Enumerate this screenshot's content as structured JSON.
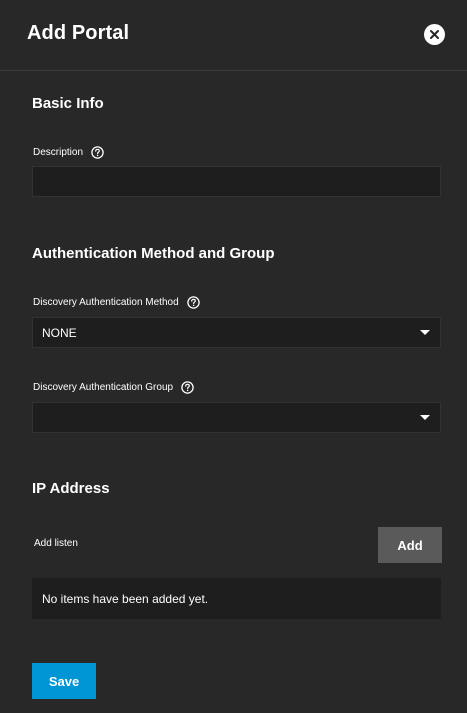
{
  "header": {
    "title": "Add Portal",
    "close_icon": "close-icon"
  },
  "basic_info": {
    "title": "Basic Info",
    "description_label": "Description",
    "description_value": ""
  },
  "auth": {
    "title": "Authentication Method and Group",
    "method_label": "Discovery Authentication Method",
    "method_value": "NONE",
    "group_label": "Discovery Authentication Group",
    "group_value": ""
  },
  "ip": {
    "title": "IP Address",
    "add_listen_label": "Add listen",
    "add_button": "Add",
    "empty_message": "No items have been added yet."
  },
  "actions": {
    "save_button": "Save"
  },
  "colors": {
    "background": "#282828",
    "input_bg": "#1e1e1e",
    "primary": "#0095d5",
    "secondary_button": "#5a5a5a"
  }
}
